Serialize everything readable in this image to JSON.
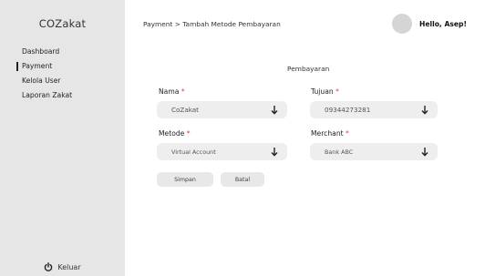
{
  "sidebar": {
    "brand": "COZakat",
    "items": [
      {
        "label": "Dashboard",
        "active": false
      },
      {
        "label": "Payment",
        "active": true
      },
      {
        "label": "Kelola User",
        "active": false
      },
      {
        "label": "Laporan Zakat",
        "active": false
      }
    ],
    "logout_label": "Keluar",
    "logout_icon": "power-icon"
  },
  "header": {
    "breadcrumb": "Payment > Tambah Metode Pembayaran",
    "greeting": "Hello, Asep!"
  },
  "form": {
    "title": "Pembayaran",
    "required_mark": "*",
    "fields": {
      "nama": {
        "label": "Nama",
        "value": "CoZakat"
      },
      "tujuan": {
        "label": "Tujuan",
        "value": "09344273281"
      },
      "metode": {
        "label": "Metode",
        "value": "Virtual Account"
      },
      "merchant": {
        "label": "Merchant",
        "value": "Bank ABC"
      }
    },
    "buttons": {
      "save": "Simpan",
      "cancel": "Batal"
    }
  },
  "colors": {
    "sidebar_bg": "#e6e6e6",
    "input_bg": "#eeeeee",
    "required": "#e23b3b"
  }
}
